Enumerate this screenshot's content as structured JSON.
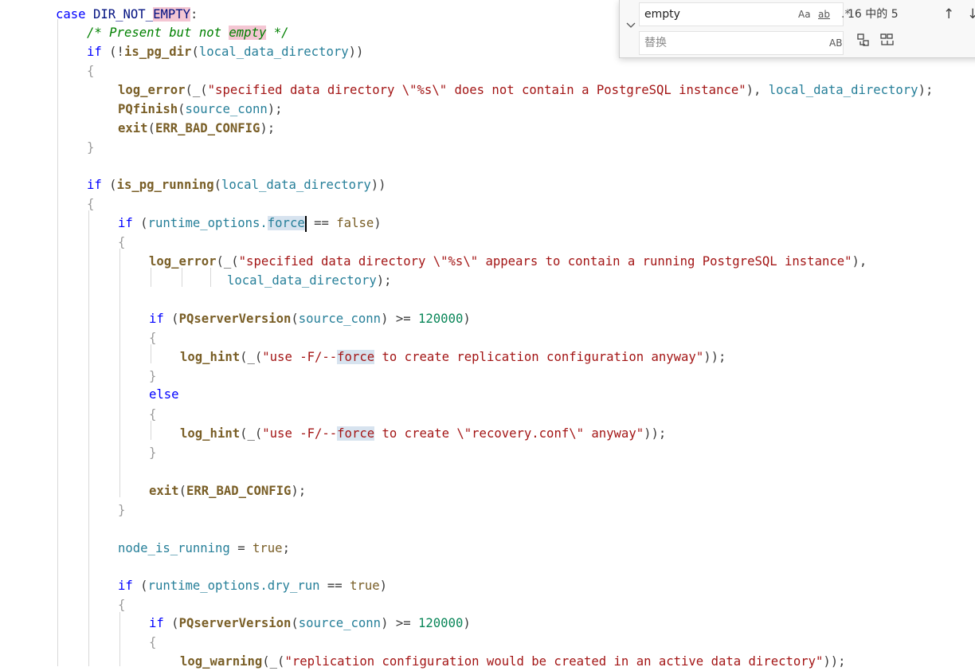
{
  "find_widget": {
    "search_value": "empty",
    "replace_placeholder": "替换",
    "toggle_icon": "chevron-down",
    "match_case_label": "Aa",
    "whole_word_label": "ab",
    "regex_label": ".*",
    "match_count": "16 中的 5",
    "prev_icon": "↑",
    "next_icon": "↓",
    "preserve_case_label": "AB",
    "replace_one_icon": "replace-icon",
    "replace_all_icon": "replace-all-icon"
  },
  "code": {
    "l01_kw": "case",
    "l01_id": "DIR_NOT_",
    "l01_hit": "EMPTY",
    "l01_colon": ":",
    "l02_a": "/* Present but not ",
    "l02_hit": "empty",
    "l02_b": " */",
    "l03_kw": "if",
    "l03_p1": " (!",
    "l03_fn": "is_pg_dir",
    "l03_p2": "(",
    "l03_var": "local_data_directory",
    "l03_p3": "))",
    "l04": "{",
    "l05_fn": "log_error",
    "l05_p1": "(_(",
    "l05_str": "\"specified data directory \\\"%s\\\" does not contain a PostgreSQL instance\"",
    "l05_p2": "), ",
    "l05_var": "local_data_directory",
    "l05_p3": ");",
    "l06_fn": "PQfinish",
    "l06_p1": "(",
    "l06_var": "source_conn",
    "l06_p2": ");",
    "l07_fn": "exit",
    "l07_p1": "(",
    "l07_mac": "ERR_BAD_CONFIG",
    "l07_p2": ");",
    "l08": "}",
    "l10_kw": "if",
    "l10_p1": " (",
    "l10_fn": "is_pg_running",
    "l10_p2": "(",
    "l10_var": "local_data_directory",
    "l10_p3": "))",
    "l11": "{",
    "l12_kw": "if",
    "l12_p1": " (",
    "l12_var": "runtime_options.",
    "l12_hit": "force",
    "l12_op": " == ",
    "l12_bool": "false",
    "l12_p2": ")",
    "l13": "{",
    "l14_fn": "log_error",
    "l14_p1": "(_(",
    "l14_str": "\"specified data directory \\\"%s\\\" appears to contain a running PostgreSQL instance\"",
    "l14_p2": "),",
    "l15_var": "local_data_directory",
    "l15_p": ");",
    "l17_kw": "if",
    "l17_p1": " (",
    "l17_fn": "PQserverVersion",
    "l17_p2": "(",
    "l17_var": "source_conn",
    "l17_p3": ") >= ",
    "l17_num": "120000",
    "l17_p4": ")",
    "l18": "{",
    "l19_fn": "log_hint",
    "l19_p1": "(_(",
    "l19_s1": "\"use -F/--",
    "l19_hit": "force",
    "l19_s2": " to create replication configuration anyway\"",
    "l19_p2": "));",
    "l20": "}",
    "l21_kw": "else",
    "l22": "{",
    "l23_fn": "log_hint",
    "l23_p1": "(_(",
    "l23_s1": "\"use -F/--",
    "l23_hit": "force",
    "l23_s2": " to create \\\"recovery.conf\\\" anyway\"",
    "l23_p2": "));",
    "l24": "}",
    "l26_fn": "exit",
    "l26_p1": "(",
    "l26_mac": "ERR_BAD_CONFIG",
    "l26_p2": ");",
    "l27": "}",
    "l29_var": "node_is_running",
    "l29_op": " = ",
    "l29_bool": "true",
    "l29_p": ";",
    "l31_kw": "if",
    "l31_p1": " (",
    "l31_var": "runtime_options.dry_run",
    "l31_op": " == ",
    "l31_bool": "true",
    "l31_p2": ")",
    "l32": "{",
    "l33_kw": "if",
    "l33_p1": " (",
    "l33_fn": "PQserverVersion",
    "l33_p2": "(",
    "l33_var": "source_conn",
    "l33_p3": ") >= ",
    "l33_num": "120000",
    "l33_p4": ")",
    "l34": "{",
    "l35_fn": "log_warning",
    "l35_p1": "(_(",
    "l35_str": "\"replication configuration would be created in an active data directory\"",
    "l35_p2": "));"
  }
}
